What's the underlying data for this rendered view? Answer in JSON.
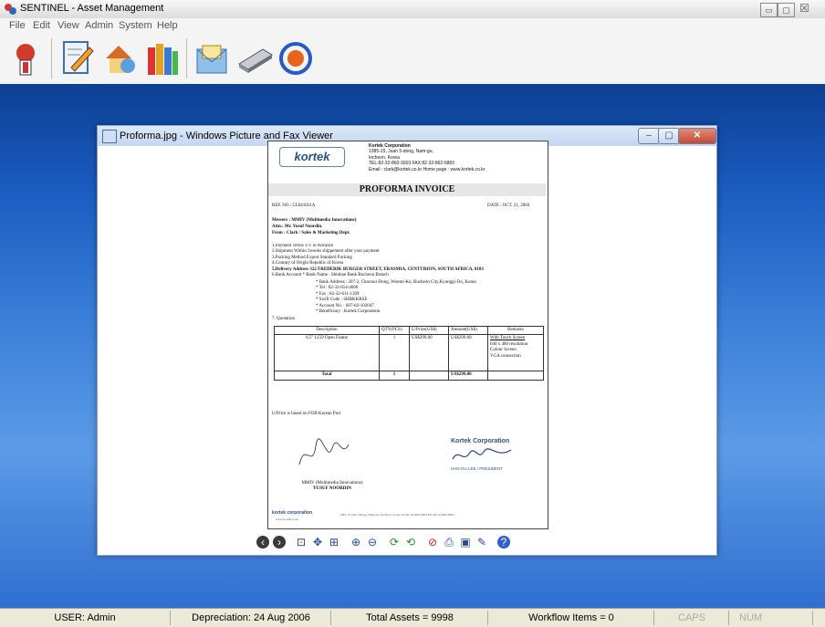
{
  "app": {
    "title": "SENTINEL - Asset Management"
  },
  "menu": [
    "File",
    "Edit",
    "View",
    "Admin",
    "System",
    "Help"
  ],
  "toolbar_icons": [
    "user-key-icon",
    "edit-document-icon",
    "assets-icon",
    "books-icon",
    "mail-box-icon",
    "scanner-icon",
    "refresh-icon"
  ],
  "viewer": {
    "title": "Proforma.jpg - Windows Picture and Fax Viewer",
    "document": {
      "logo": "kortek",
      "company": "Kortek Corporation",
      "addr1": "1385-15, Juan 5-dong, Nam-gu,",
      "addr2": "Incheon, Korea",
      "tel": "TEL:82-32-860-3003  FAX:82-32-862-6883",
      "email": "Email : clark@kortek.co.kr      Home page : www.kortek.co.kr",
      "heading": "PROFORMA INVOICE",
      "ref": "REF. NO.: CL041021A",
      "date": "DATE : OCT. 21, 2004",
      "messrs": "Messers : MMIV (Multimedia Innovations)",
      "attn": "Attn.: Mr. Yusuf Noordin.",
      "from": "From : Clark / Sales & Marketing Dept.",
      "terms": [
        "1.Payment Terms    T/T in Advance",
        "2.Shipment           Within 3weeks shippement after your payment",
        "3.Packing Method   Export Standard Packing",
        "4.Country of Origin Republic of Korea",
        "5.Delivery Address  322 FREDERIK BURGER STREET, ERASMIA, CENTURION, SOUTH AFRICA, 0183",
        "6.Bank Account      * Bank Name : Shinhan Bank Bucheon Branch"
      ],
      "bank": [
        "* Bank Address : 207-2, Choonui-Dong, Wonmi-Ku, Bucheon City,Kyunggi-Do, Korea",
        "* Tel : 82-32-654-4600",
        "* Fax : 82-32-611-1309",
        "* Swift Code : SHBKKRSE",
        "* Account No. : 607-82-102047",
        "* Beneficiary : Kortek Corporation"
      ],
      "quotation": "7. Quotation",
      "table_headers": [
        "Description",
        "QTY(PCS)",
        "U/Price(US$)",
        "Amount(US$)",
        "Remarks"
      ],
      "row": [
        "6.5\" LCD Open  Frame",
        "1",
        "US$299.00",
        "US$299.00"
      ],
      "remarks": [
        "With Touch Screen",
        "640 x 480 resolution",
        "Colour Screen",
        "VGA connection"
      ],
      "total_row": [
        "Total",
        "1",
        "",
        "US$299.00",
        ""
      ],
      "note": "U/Price is based on FOB Korean Port",
      "buyer": "MMIV (Multimedia Innovations)",
      "buyer_name": "YUSUF NOORDIN",
      "seller": "Kortek Corporation",
      "seller_name": "HAN-GU LEE / PRESIDENT",
      "footer_logo": "kortek corporation",
      "footer_web": "www.kortek.co.kr",
      "footer_addr": "1385-15 Juan-5Dong, Nam-Ku, Incheon, Korea    Tel 82-32-860-3003  Fax 82-32-862-6883"
    }
  },
  "status": {
    "user": "USER: Admin",
    "depreciation": "Depreciation: 24 Aug 2006",
    "assets": "Total Assets = 9998",
    "workflow": "Workflow Items = 0",
    "caps": "CAPS",
    "num": "NUM"
  },
  "colors": {
    "desktop": "#1a5cc0",
    "logo": "#2b4f86"
  }
}
